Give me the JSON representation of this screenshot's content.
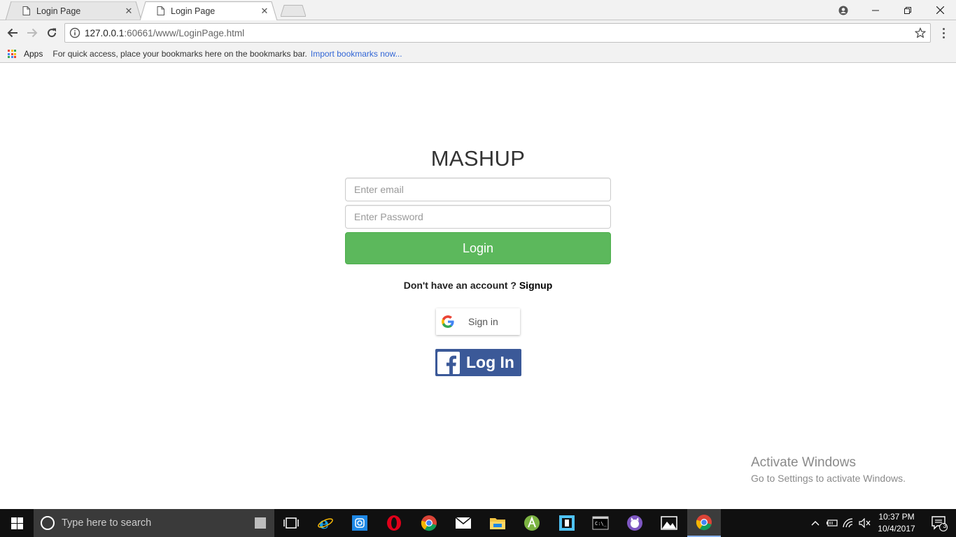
{
  "browser": {
    "tabs": [
      {
        "title": "Login Page",
        "active": false
      },
      {
        "title": "Login Page",
        "active": true
      }
    ],
    "url_host": "127.0.0.1",
    "url_rest": ":60661/www/LoginPage.html",
    "bookmarks": {
      "apps_label": "Apps",
      "hint": "For quick access, place your bookmarks here on the bookmarks bar.",
      "import_link": "Import bookmarks now..."
    }
  },
  "page": {
    "title": "MASHUP",
    "email_placeholder": "Enter email",
    "password_placeholder": "Enter Password",
    "login_label": "Login",
    "signup_prompt": "Don't have an account ?",
    "signup_link": "Signup",
    "google_label": "Sign in",
    "facebook_label": "Log In"
  },
  "watermark": {
    "line1": "Activate Windows",
    "line2": "Go to Settings to activate Windows."
  },
  "taskbar": {
    "search_placeholder": "Type here to search",
    "time": "10:37 PM",
    "date": "10/4/2017",
    "notification_count": "3",
    "icons": [
      "task-view",
      "internet-explorer",
      "instagram",
      "opera",
      "chrome",
      "mail",
      "file-explorer",
      "android-studio",
      "app",
      "command-prompt",
      "github",
      "photos",
      "chrome"
    ]
  },
  "colors": {
    "login_green": "#5cb85c",
    "facebook_blue": "#3b5998",
    "link_blue": "#3367d6"
  }
}
